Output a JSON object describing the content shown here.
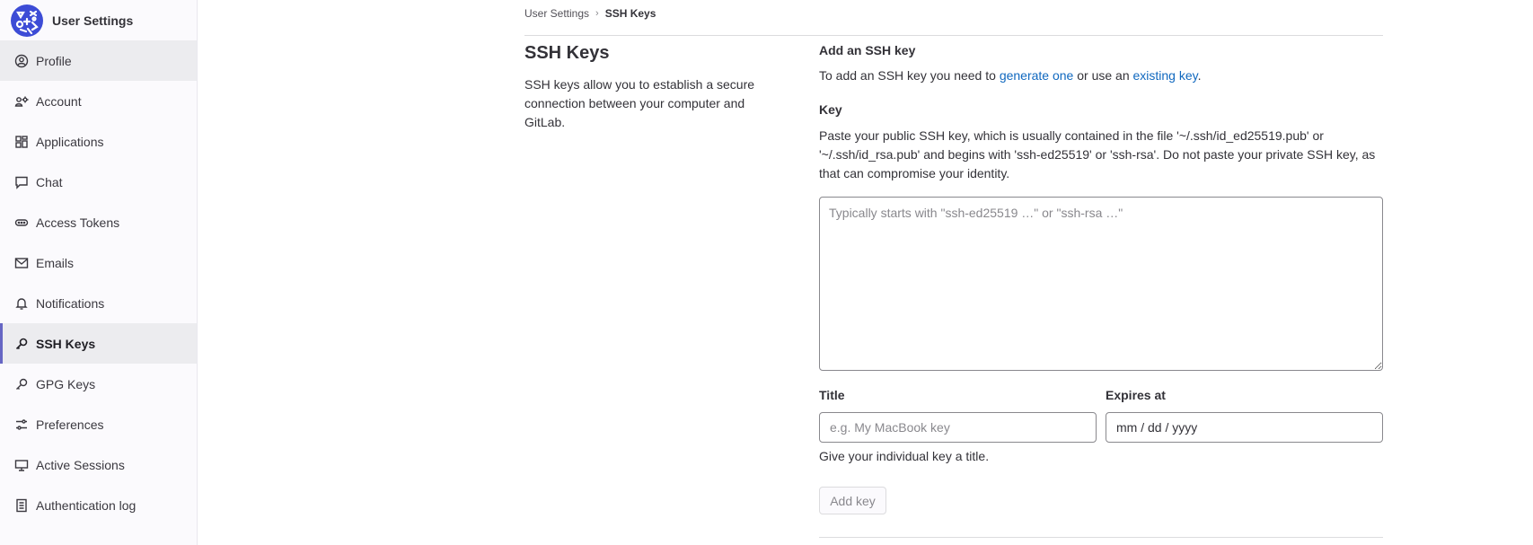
{
  "app": {
    "title": "User Settings"
  },
  "sidebar": {
    "items": [
      {
        "label": "Profile",
        "icon": "profile-icon",
        "state": "hover"
      },
      {
        "label": "Account",
        "icon": "account-icon"
      },
      {
        "label": "Applications",
        "icon": "applications-icon"
      },
      {
        "label": "Chat",
        "icon": "chat-icon"
      },
      {
        "label": "Access Tokens",
        "icon": "token-icon"
      },
      {
        "label": "Emails",
        "icon": "mail-icon"
      },
      {
        "label": "Notifications",
        "icon": "notifications-icon"
      },
      {
        "label": "SSH Keys",
        "icon": "key-icon",
        "state": "active"
      },
      {
        "label": "GPG Keys",
        "icon": "key-icon"
      },
      {
        "label": "Preferences",
        "icon": "preferences-icon"
      },
      {
        "label": "Active Sessions",
        "icon": "monitor-icon"
      },
      {
        "label": "Authentication log",
        "icon": "log-icon"
      }
    ]
  },
  "breadcrumb": {
    "parent": "User Settings",
    "separator": "›",
    "current": "SSH Keys"
  },
  "page": {
    "title": "SSH Keys",
    "description": "SSH keys allow you to establish a secure connection between your computer and GitLab."
  },
  "form": {
    "heading": "Add an SSH key",
    "intro_prefix": "To add an SSH key you need to ",
    "link_generate": "generate one",
    "intro_middle": " or use an ",
    "link_existing": "existing key",
    "intro_suffix": ".",
    "key_label": "Key",
    "key_help": "Paste your public SSH key, which is usually contained in the file '~/.ssh/id_ed25519.pub' or '~/.ssh/id_rsa.pub' and begins with 'ssh-ed25519' or 'ssh-rsa'. Do not paste your private SSH key, as that can compromise your identity.",
    "key_placeholder": "Typically starts with \"ssh-ed25519 …\" or \"ssh-rsa …\"",
    "title_label": "Title",
    "title_placeholder": "e.g. My MacBook key",
    "expires_label": "Expires at",
    "expires_value": "mm / dd / yyyy",
    "title_help": "Give your individual key a title.",
    "submit_label": "Add key"
  },
  "colors": {
    "link": "#1068bf",
    "active_indicator": "#6666c4",
    "logo": "#3d4cd6"
  }
}
